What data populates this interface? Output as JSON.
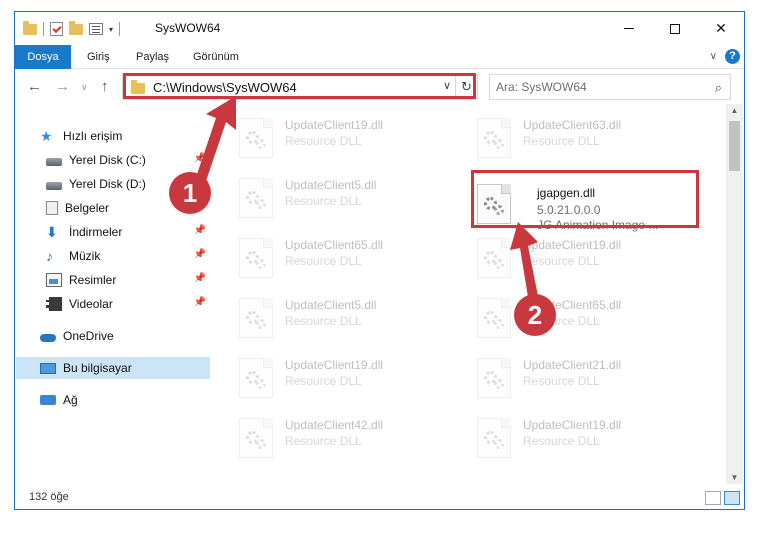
{
  "window": {
    "title": "SysWOW64"
  },
  "ribbon": {
    "tabs": [
      "Dosya",
      "Giriş",
      "Paylaş",
      "Görünüm"
    ]
  },
  "address": {
    "path": "C:\\Windows\\SysWOW64"
  },
  "search": {
    "placeholder": "Ara: SysWOW64"
  },
  "sidebar": {
    "items": [
      {
        "label": "Hızlı erişim",
        "icon": "star-icon"
      },
      {
        "label": "Yerel Disk (C:)",
        "icon": "drive-icon"
      },
      {
        "label": "Yerel Disk (D:)",
        "icon": "drive-icon"
      },
      {
        "label": "Belgeler",
        "icon": "documents-icon"
      },
      {
        "label": "İndirmeler",
        "icon": "download-icon"
      },
      {
        "label": "Müzik",
        "icon": "music-icon"
      },
      {
        "label": "Resimler",
        "icon": "pictures-icon"
      },
      {
        "label": "Videolar",
        "icon": "videos-icon"
      },
      {
        "label": "OneDrive",
        "icon": "cloud-icon"
      },
      {
        "label": "Bu bilgisayar",
        "icon": "computer-icon"
      },
      {
        "label": "Ağ",
        "icon": "network-icon"
      }
    ]
  },
  "files": {
    "left": [
      {
        "name": "UpdateClient19.dll",
        "type": "Resource DLL"
      },
      {
        "name": "UpdateClient5.dll",
        "type": "Resource DLL"
      },
      {
        "name": "UpdateClient65.dll",
        "type": "Resource DLL"
      },
      {
        "name": "UpdateClient5.dll",
        "type": "Resource DLL"
      },
      {
        "name": "UpdateClient19.dll",
        "type": "Resource DLL"
      },
      {
        "name": "UpdateClient42.dll",
        "type": "Resource DLL"
      }
    ],
    "right": [
      {
        "name": "UpdateClient63.dll",
        "type": "Resource DLL"
      },
      {
        "name": "UpdateClient19.dll",
        "type": "Resource DLL"
      },
      {
        "name": "UpdateClient65.dll",
        "type": "Resource DLL"
      },
      {
        "name": "UpdateClient21.dll",
        "type": "Resource DLL"
      },
      {
        "name": "UpdateClient19.dll",
        "type": "Resource DLL"
      }
    ],
    "highlighted": {
      "name": "jgapgen.dll",
      "version": "5.0.21.0.0.0",
      "description": "JG Animation Image ..."
    }
  },
  "status": {
    "count": "132 öğe"
  },
  "callouts": {
    "one": "1",
    "two": "2"
  },
  "colors": {
    "accent": "#1979ca",
    "callout": "#c9383f"
  }
}
